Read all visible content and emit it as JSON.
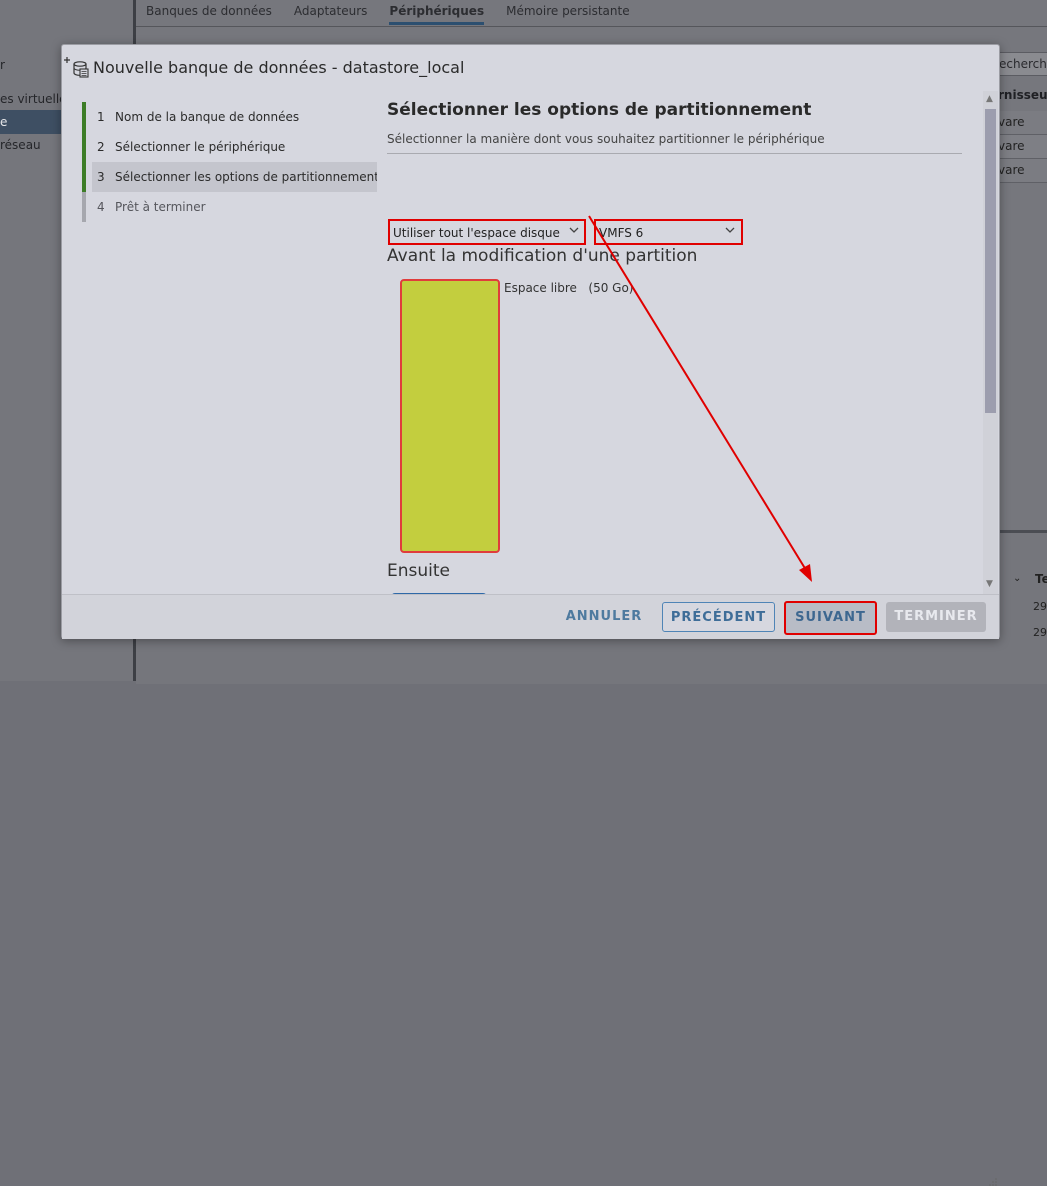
{
  "background": {
    "tabs": [
      {
        "label": "Banques de données",
        "active": false
      },
      {
        "label": "Adaptateurs",
        "active": false
      },
      {
        "label": "Périphériques",
        "active": true
      },
      {
        "label": "Mémoire persistante",
        "active": false
      }
    ],
    "nav": {
      "item_r": "r",
      "item_virtual": "es virtuelle",
      "item_selected": "e",
      "item_network": "réseau"
    },
    "search_text": "echerch",
    "table_header": "rnisseur",
    "rows": [
      "vare",
      "vare",
      "vare"
    ],
    "bottom_header": "Te",
    "bottom_cells": [
      "29",
      "29"
    ]
  },
  "modal": {
    "title": "Nouvelle banque de données - datastore_local",
    "steps": [
      {
        "num": "1",
        "label": "Nom de la banque de données",
        "state": "done"
      },
      {
        "num": "2",
        "label": "Sélectionner le périphérique",
        "state": "done"
      },
      {
        "num": "3",
        "label": "Sélectionner les options de partitionnement",
        "state": "current"
      },
      {
        "num": "4",
        "label": "Prêt à terminer",
        "state": "todo"
      }
    ],
    "content": {
      "title": "Sélectionner les options de partitionnement",
      "subtitle": "Sélectionner la manière dont vous souhaitez partitionner le périphérique",
      "partition_select": "Utiliser tout l'espace disque",
      "fs_select": "VMFS 6",
      "before_title": "Avant la modification d'une partition",
      "free_space_label": "Espace libre",
      "free_space_size": "(50 Go)",
      "after_title": "Ensuite"
    },
    "buttons": {
      "cancel": "ANNULER",
      "previous": "PRÉCÉDENT",
      "next": "SUIVANT",
      "finish": "TERMINER"
    },
    "colors": {
      "step_done": "#3d7d27",
      "partition_free": "#c3ce3e",
      "annotation": "#e00000"
    }
  }
}
